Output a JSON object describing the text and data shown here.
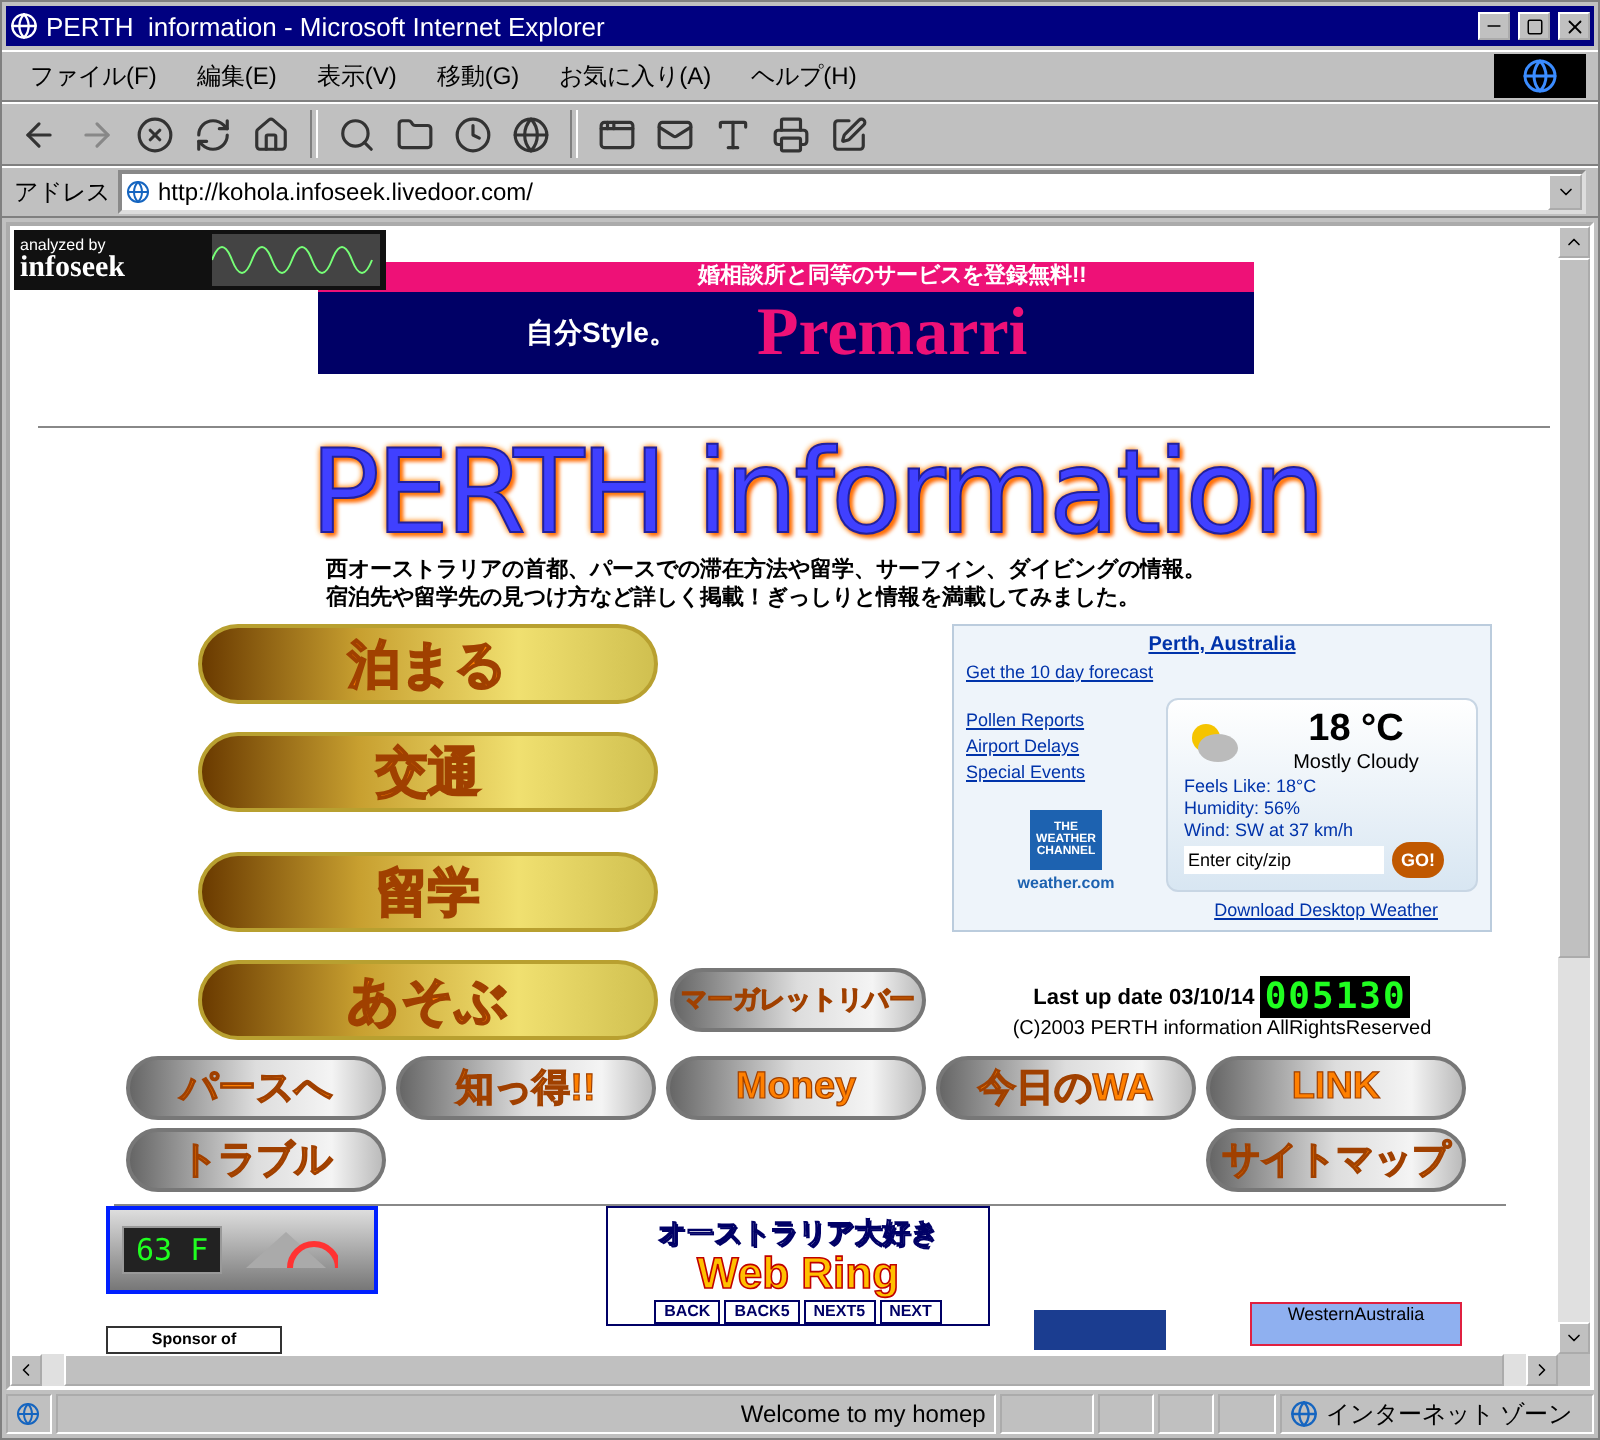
{
  "window": {
    "title": "PERTH  information - Microsoft Internet Explorer"
  },
  "menu": [
    {
      "label": "ファイル(F)"
    },
    {
      "label": "編集(E)"
    },
    {
      "label": "表示(V)"
    },
    {
      "label": "移動(G)"
    },
    {
      "label": "お気に入り(A)"
    },
    {
      "label": "ヘルプ(H)"
    }
  ],
  "address_bar": {
    "label": "アドレス",
    "url": "http://kohola.infoseek.livedoor.com/"
  },
  "page": {
    "analyzer_badge": {
      "caption": "analyzed by",
      "brand": "infoseek"
    },
    "banner": {
      "headline": "婚相談所と同等のサービスを登録無料!!",
      "tagline": "自分Style。",
      "brand": "Premarri"
    },
    "heading": "PERTH information",
    "intro": [
      "西オーストラリアの首都、パースでの滞在方法や留学、サーフィン、ダイビングの情報。",
      "宿泊先や留学先の見つけ方など詳しく掲載！ぎっしりと情報を満載してみました。"
    ],
    "main_buttons": [
      {
        "label": "泊まる"
      },
      {
        "label": "交通"
      },
      {
        "label": "留学"
      },
      {
        "label": "あそぶ"
      }
    ],
    "side_button": {
      "label": "マーガレットリバー"
    },
    "weather": {
      "city": "Perth, Australia",
      "forecast_link": "Get the 10 day forecast",
      "links": [
        "Pollen Reports",
        "Airport Delays",
        "Special Events"
      ],
      "temperature": "18 °C",
      "condition": "Mostly Cloudy",
      "details": [
        "Feels Like: 18°C",
        "Humidity: 56%",
        "Wind: SW at 37 km/h"
      ],
      "search_value": "Enter city/zip",
      "go": "GO!",
      "logo": [
        "THE",
        "WEATHER",
        "CHANNEL"
      ],
      "logo_site": "weather.com",
      "download_link": "Download Desktop Weather"
    },
    "last_update": "Last up date 03/10/14",
    "hit_counter": "005130",
    "copyright": "(C)2003 PERTH information AllRightsReserved",
    "sub_buttons": [
      [
        {
          "label": "パースへ"
        },
        {
          "label": "知っ得!!"
        },
        {
          "label": "Money"
        },
        {
          "label": "今日のWA"
        },
        {
          "label": "LINK"
        }
      ],
      [
        {
          "label": "トラブル"
        },
        {
          "label": "サイトマップ"
        }
      ]
    ],
    "thermometer": {
      "reading": "63",
      "unit": "F"
    },
    "webring": {
      "title": "オーストラリア大好き",
      "subtitle": "Web Ring",
      "links": [
        "BACK",
        "BACK5",
        "NEXT5",
        "NEXT"
      ]
    },
    "sponsor": "Sponsor of",
    "wa_banner": "WesternAustralia"
  },
  "status_bar": {
    "text": "Welcome to my homep",
    "zone": "インターネット ゾーン"
  }
}
